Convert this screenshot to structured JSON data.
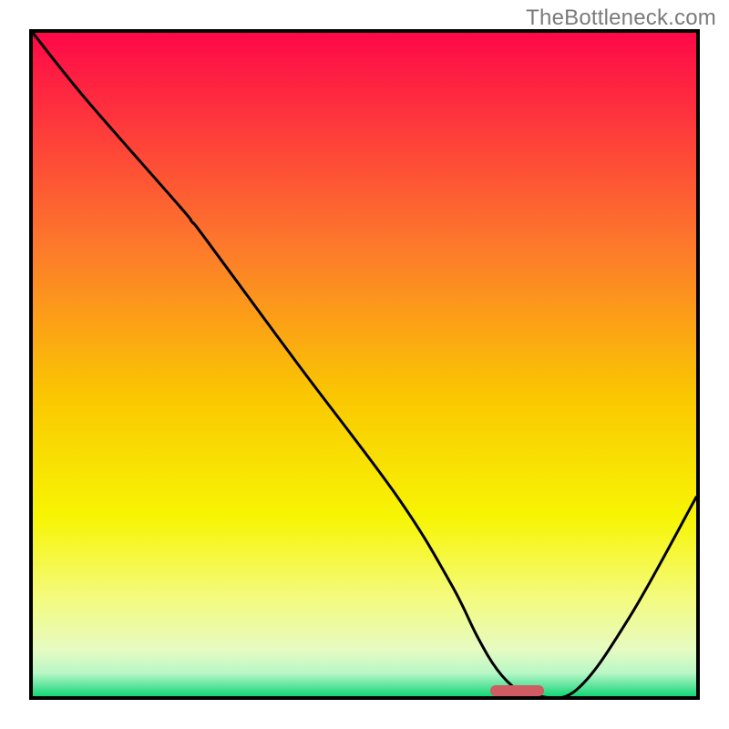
{
  "watermark": "TheBottleneck.com",
  "colors": {
    "border": "#000000",
    "curve": "#000000",
    "ideal_bar": "#cf5b63",
    "gradient_stops": [
      {
        "offset": 0.0,
        "color": "#fe0848"
      },
      {
        "offset": 0.33,
        "color": "#fd7c2a"
      },
      {
        "offset": 0.55,
        "color": "#fac801"
      },
      {
        "offset": 0.73,
        "color": "#f7f503"
      },
      {
        "offset": 0.85,
        "color": "#f4fb7c"
      },
      {
        "offset": 0.93,
        "color": "#e6fbc2"
      },
      {
        "offset": 0.965,
        "color": "#b8f7c6"
      },
      {
        "offset": 0.985,
        "color": "#5be39c"
      },
      {
        "offset": 1.0,
        "color": "#12d874"
      }
    ]
  },
  "chart_data": {
    "type": "line",
    "title": "",
    "xlabel": "",
    "ylabel": "",
    "xlim": [
      0,
      100
    ],
    "ylim": [
      0,
      100
    ],
    "series": [
      {
        "name": "bottleneck-curve",
        "x": [
          0,
          8,
          22,
          24,
          26,
          40,
          55,
          63,
          67,
          70,
          73,
          76,
          82,
          90,
          100
        ],
        "values": [
          100,
          90,
          74,
          71.5,
          69,
          50,
          30,
          17,
          9,
          4,
          1,
          0,
          1,
          12,
          30
        ]
      }
    ],
    "annotations": {
      "ideal_bar": {
        "x_start": 69,
        "x_end": 77,
        "y": 0,
        "height": 1.6
      },
      "left_shoulder": {
        "x": 22,
        "y": 74
      }
    }
  }
}
